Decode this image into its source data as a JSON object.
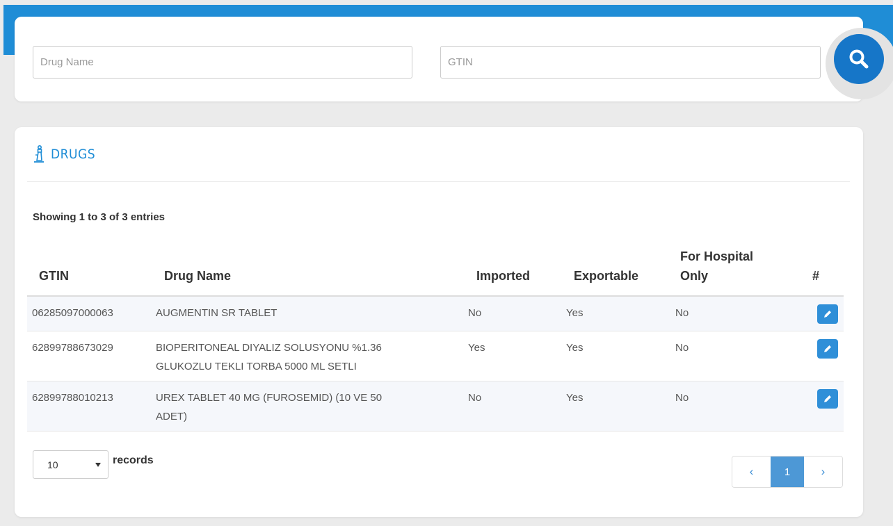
{
  "search": {
    "drug_name_placeholder": "Drug Name",
    "gtin_placeholder": "GTIN"
  },
  "drugs_card": {
    "title": "DRUGS",
    "entries_info": "Showing 1 to 3 of 3 entries"
  },
  "table": {
    "headers": {
      "gtin": "GTIN",
      "drug_name": "Drug Name",
      "imported": "Imported",
      "exportable": "Exportable",
      "hospital_line1": "For Hospital",
      "hospital_line2": "Only",
      "action": "#"
    },
    "rows": [
      {
        "gtin": "06285097000063",
        "name_line1": "AUGMENTIN SR TABLET",
        "name_line2": "",
        "imported": "No",
        "exportable": "Yes",
        "hospital_only": "No"
      },
      {
        "gtin": "62899788673029",
        "name_line1": "BIOPERITONEAL DIYALIZ SOLUSYONU %1.36",
        "name_line2": "GLUKOZLU TEKLI TORBA 5000 ML SETLI",
        "imported": "Yes",
        "exportable": "Yes",
        "hospital_only": "No"
      },
      {
        "gtin": "62899788010213",
        "name_line1": "UREX TABLET 40 MG (FUROSEMID) (10 VE 50",
        "name_line2": "ADET)",
        "imported": "No",
        "exportable": "Yes",
        "hospital_only": "No"
      }
    ]
  },
  "footer": {
    "page_size_value": "10",
    "records_label": "records",
    "prev_symbol": "‹",
    "current_page": "1",
    "next_symbol": "›"
  },
  "colors": {
    "primary": "#1f8dd6",
    "search_button": "#1676c8",
    "edit_button": "#2f8fd8",
    "active_page": "#4d98d6"
  },
  "icons": {
    "search": "magnifier-icon",
    "title": "drug-dropper-icon",
    "edit": "pencil-icon",
    "select_arrow": "caret-down-icon"
  }
}
